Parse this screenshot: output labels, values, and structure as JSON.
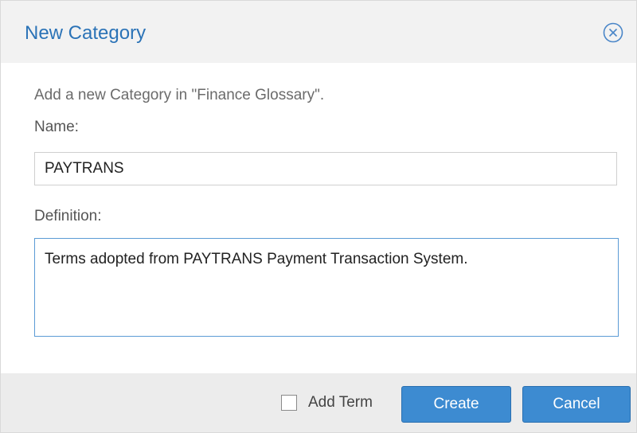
{
  "dialog": {
    "title": "New Category",
    "close_icon": "close-circle-icon"
  },
  "form": {
    "intro_text": "Add a new Category in \"Finance Glossary\".",
    "name_label": "Name:",
    "name_value": "PAYTRANS",
    "definition_label": "Definition:",
    "definition_value": "Terms adopted from PAYTRANS Payment Transaction System."
  },
  "footer": {
    "add_term_label": "Add Term",
    "add_term_checked": false,
    "create_label": "Create",
    "cancel_label": "Cancel"
  },
  "colors": {
    "title": "#2b73b7",
    "button": "#3d8bd1",
    "header_bg": "#f2f2f2",
    "footer_bg": "#ececec"
  }
}
